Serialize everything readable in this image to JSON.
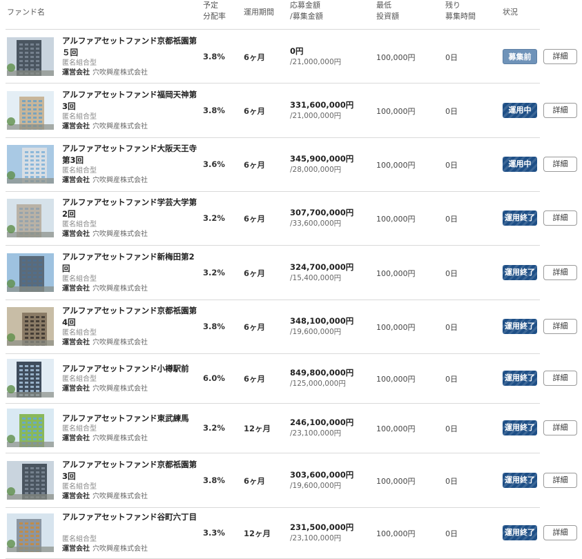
{
  "header": {
    "fund_name": "ファンド名",
    "rate": "予定\n分配率",
    "period": "運用期間",
    "amount": "応募金額\n/募集金額",
    "min_invest": "最低\n投資額",
    "remaining": "残り\n募集時間",
    "status": "状況"
  },
  "funds": [
    {
      "title": "アルファアセットファンド京都祇園第５回",
      "type": "匿名組合型",
      "company_label": "運営会社",
      "company": "穴吹興産株式会社",
      "rate": "3.8%",
      "period": "6ヶ月",
      "applied": "0円",
      "target": "/21,000,000円",
      "min_invest": "100,000円",
      "remaining": "0日",
      "status": "募集前",
      "status_kind": "pre",
      "detail": "詳細",
      "image": "building-photo"
    },
    {
      "title": "アルファアセットファンド福岡天神第3回",
      "type": "匿名組合型",
      "company_label": "運営会社",
      "company": "穴吹興産株式会社",
      "rate": "3.8%",
      "period": "6ヶ月",
      "applied": "331,600,000円",
      "target": "/21,000,000円",
      "min_invest": "100,000円",
      "remaining": "0日",
      "status": "運用中",
      "status_kind": "active",
      "detail": "詳細",
      "image": "building-photo"
    },
    {
      "title": "アルファアセットファンド大阪天王寺　第3回",
      "type": "匿名組合型",
      "company_label": "運営会社",
      "company": "穴吹興産株式会社",
      "rate": "3.6%",
      "period": "6ヶ月",
      "applied": "345,900,000円",
      "target": "/28,000,000円",
      "min_invest": "100,000円",
      "remaining": "0日",
      "status": "運用中",
      "status_kind": "active",
      "detail": "詳細",
      "image": "building-photo"
    },
    {
      "title": "アルファアセットファンド学芸大学第2回",
      "type": "匿名組合型",
      "company_label": "運営会社",
      "company": "穴吹興産株式会社",
      "rate": "3.2%",
      "period": "6ヶ月",
      "applied": "307,700,000円",
      "target": "/33,600,000円",
      "min_invest": "100,000円",
      "remaining": "0日",
      "status": "運用終了",
      "status_kind": "ended",
      "detail": "詳細",
      "image": "building-photo"
    },
    {
      "title": "アルファアセットファンド新梅田第2回",
      "type": "匿名組合型",
      "company_label": "運営会社",
      "company": "穴吹興産株式会社",
      "rate": "3.2%",
      "period": "6ヶ月",
      "applied": "324,700,000円",
      "target": "/15,400,000円",
      "min_invest": "100,000円",
      "remaining": "0日",
      "status": "運用終了",
      "status_kind": "ended",
      "detail": "詳細",
      "image": "building-photo"
    },
    {
      "title": "アルファアセットファンド京都祇園第4回",
      "type": "匿名組合型",
      "company_label": "運営会社",
      "company": "穴吹興産株式会社",
      "rate": "3.8%",
      "period": "6ヶ月",
      "applied": "348,100,000円",
      "target": "/19,600,000円",
      "min_invest": "100,000円",
      "remaining": "0日",
      "status": "運用終了",
      "status_kind": "ended",
      "detail": "詳細",
      "image": "building-photo"
    },
    {
      "title": "アルファアセットファンド小樽駅前",
      "type": "匿名組合型",
      "company_label": "運営会社",
      "company": "穴吹興産株式会社",
      "rate": "6.0%",
      "period": "6ヶ月",
      "applied": "849,800,000円",
      "target": "/125,000,000円",
      "min_invest": "100,000円",
      "remaining": "0日",
      "status": "運用終了",
      "status_kind": "ended",
      "detail": "詳細",
      "image": "building-photo"
    },
    {
      "title": "アルファアセットファンド東武練馬",
      "type": "匿名組合型",
      "company_label": "運営会社",
      "company": "穴吹興産株式会社",
      "rate": "3.2%",
      "period": "12ヶ月",
      "applied": "246,100,000円",
      "target": "/23,100,000円",
      "min_invest": "100,000円",
      "remaining": "0日",
      "status": "運用終了",
      "status_kind": "ended",
      "detail": "詳細",
      "image": "building-photo"
    },
    {
      "title": "アルファアセットファンド京都祇園第3回",
      "type": "匿名組合型",
      "company_label": "運営会社",
      "company": "穴吹興産株式会社",
      "rate": "3.8%",
      "period": "6ヶ月",
      "applied": "303,600,000円",
      "target": "/19,600,000円",
      "min_invest": "100,000円",
      "remaining": "0日",
      "status": "運用終了",
      "status_kind": "ended",
      "detail": "詳細",
      "image": "building-photo"
    },
    {
      "title": "アルファアセットファンド谷町六丁目",
      "type": "匿名組合型",
      "company_label": "運営会社",
      "company": "穴吹興産株式会社",
      "rate": "3.3%",
      "period": "12ヶ月",
      "applied": "231,500,000円",
      "target": "/23,100,000円",
      "min_invest": "100,000円",
      "remaining": "0日",
      "status": "運用終了",
      "status_kind": "ended",
      "detail": "詳細",
      "image": "building-photo"
    }
  ]
}
